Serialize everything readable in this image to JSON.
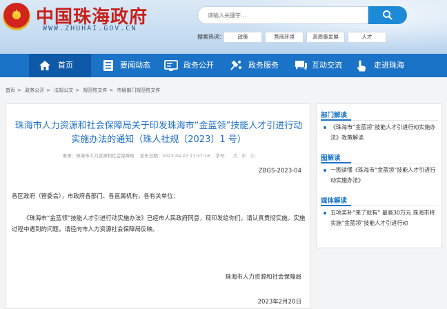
{
  "header": {
    "site_title": "中国珠海政府",
    "site_domain": "WWW.ZHUHAI.GOV.CN",
    "search_placeholder": "请输入关键字...",
    "hot_label": "搜索热词：",
    "hot_tags": [
      "政策",
      "营商环境",
      "高质量发展",
      "人才"
    ]
  },
  "nav": {
    "items": [
      {
        "label": "首页",
        "icon": "home-icon"
      },
      {
        "label": "要闻动态",
        "icon": "news-icon"
      },
      {
        "label": "政务公开",
        "icon": "public-info-icon"
      },
      {
        "label": "政务服务",
        "icon": "service-icon"
      },
      {
        "label": "互动交流",
        "icon": "chat-icon"
      },
      {
        "label": "走进珠海",
        "icon": "hand-pointer-icon"
      }
    ]
  },
  "breadcrumb": [
    "首页",
    "政务公开",
    "法规公文",
    "规范性文件",
    "市级部门规范性文件"
  ],
  "breadcrumb_sep": ">",
  "article": {
    "title": "珠海市人力资源和社会保障局关于印发珠海市“金蓝领”技能人才引进行动实施办法的通知（珠人社规〔2023〕1 号）",
    "source": "来源：珠海市人力资源和社会保障局",
    "publish_time": "发布日期：2023-04-07 17:37:18",
    "font_size_label": "字号：",
    "font_sizes": [
      "大",
      "中",
      "小"
    ],
    "doc_no": "ZBGS-2023-04",
    "addressee": "各区政府（管委会），市政府各部门、各直属机构，各有关单位：",
    "body": "《珠海市“金蓝领”技能人才引进行动实施办法》已经市人民政府同意，现印发给你们，请认真贯彻实施。实施过程中遇到的问题，请径向市人力资源社会保障局反映。",
    "signer": "珠海市人力资源和社会保障局",
    "date": "2023年2月20日"
  },
  "sidebar": {
    "sections": [
      {
        "title": "部门解读",
        "items": [
          "《珠海市“金蓝领”技能人才引进行动实施办法》政策解读"
        ]
      },
      {
        "title": "图解读",
        "items": [
          "一图读懂《珠海市“金蓝领”技能人才引进行动实施办法》"
        ]
      },
      {
        "title": "媒体解读",
        "items": [
          "五项奖补“来了就有” 最高30万元 珠海市将实施“金蓝领”技能人才引进行动"
        ]
      }
    ]
  },
  "colors": {
    "brand_red": "#c8201a",
    "nav_blue": "#1b73c7",
    "nav_active": "#0e59a8",
    "link_blue": "#1d6fc4"
  }
}
